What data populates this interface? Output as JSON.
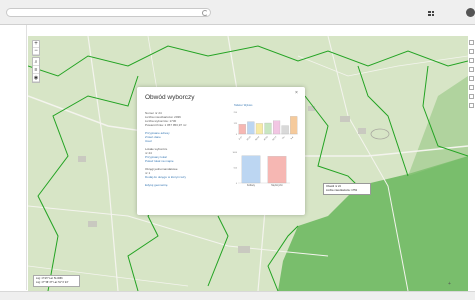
{
  "popup": {
    "title": "Obwód wyborczy",
    "close": "×",
    "info_lines": [
      "Numer nr 24",
      "Liczba mieszkańców: 2036",
      "Liczba wyborców: 1730",
      "Powierzchnia: 1 057 953,97 m²"
    ],
    "links_a": [
      "Przypisane adresy",
      "Zmień dane",
      "Usuń"
    ],
    "group_b": [
      "Lokale wyborcze",
      "nr 24"
    ],
    "links_b": [
      "Przypisany lokal",
      "Pokaż lokal na mapie"
    ],
    "group_c": [
      "Okręgi jednomandatowe",
      "nr 1"
    ],
    "links_c": [
      "Dodaj do okręgu w którym leży"
    ],
    "links_d": [
      "Edytuj geometrię"
    ],
    "chart_link": "Tabela / Wykres",
    "legend": [
      "Kobiety",
      "Mężczyźni"
    ]
  },
  "tooltip": {
    "line1": "Obwód nr 24",
    "line2": "Liczba mieszkańców: 1753"
  },
  "coords": {
    "line1": "Lng: 17.977 Lat: 51.0066",
    "line2": "Lng: 17° 58' 37\" Lat: 51° 0' 24\""
  },
  "zoom": {
    "plus": "+",
    "minus": "−"
  },
  "chart_data": [
    {
      "type": "bar",
      "title": "",
      "categories": [
        "0-17",
        "18-29",
        "30-44",
        "45-59",
        "60-74",
        "75+",
        "b.d."
      ],
      "values": [
        110,
        140,
        120,
        125,
        150,
        95,
        200
      ],
      "colors": [
        "#f6b7b3",
        "#bcd6f2",
        "#f7eaa6",
        "#c8e6c2",
        "#f2c6e3",
        "#d9d9d9",
        "#f5ca9c"
      ],
      "ylim": [
        0,
        250
      ]
    },
    {
      "type": "bar",
      "title": "",
      "categories": [
        "Kobiety",
        "Mężczyźni"
      ],
      "values": [
        880,
        860
      ],
      "colors": [
        "#bcd6f2",
        "#f6b7b3"
      ],
      "ylim": [
        0,
        1000
      ]
    }
  ]
}
